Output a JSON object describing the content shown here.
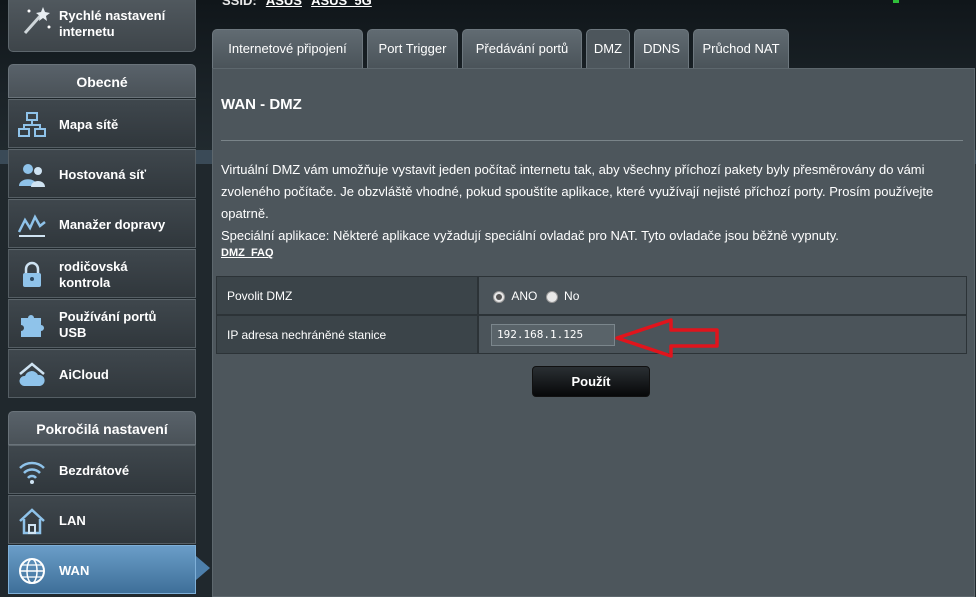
{
  "header": {
    "ssid_label": "SSID:",
    "ssid_1": "ASUS",
    "ssid_2": "ASUS_5G"
  },
  "sidebar": {
    "quick_setup": "Rychlé nastavení internetu",
    "general_header": "Obecné",
    "general_items": [
      {
        "label": "Mapa sítě",
        "icon": "network-map-icon"
      },
      {
        "label": "Hostovaná síť",
        "icon": "guest-network-icon"
      },
      {
        "label": "Manažer dopravy",
        "icon": "traffic-manager-icon"
      },
      {
        "label": "rodičovská kontrola",
        "icon": "parental-control-lock-icon"
      },
      {
        "label": "Používání portů USB",
        "icon": "usb-puzzle-icon"
      },
      {
        "label": "AiCloud",
        "icon": "aicloud-icon"
      }
    ],
    "advanced_header": "Pokročilá nastavení",
    "advanced_items": [
      {
        "label": "Bezdrátové",
        "icon": "wireless-icon"
      },
      {
        "label": "LAN",
        "icon": "home-lan-icon"
      },
      {
        "label": "WAN",
        "icon": "globe-wan-icon",
        "active": true
      }
    ]
  },
  "tabs": [
    {
      "label": "Internetové připojení"
    },
    {
      "label": "Port Trigger"
    },
    {
      "label": "Předávání portů"
    },
    {
      "label": "DMZ",
      "active": true
    },
    {
      "label": "DDNS"
    },
    {
      "label": "Průchod NAT"
    }
  ],
  "main": {
    "title": "WAN - DMZ",
    "description_1": "Virtuální DMZ vám umožňuje vystavit jeden počítač internetu tak, aby všechny příchozí pakety byly přesměrovány do vámi zvoleného počítače. Je obzvláště vhodné, pokud spouštíte aplikace, které využívají nejisté příchozí porty. Prosím používejte opatrně.",
    "description_2": "Speciální aplikace: Některé aplikace vyžadují speciální ovladač pro NAT. Tyto ovladače jsou běžně vypnuty.",
    "faq_link": "DMZ_FAQ",
    "enable_dmz_label": "Povolit DMZ",
    "enable_yes": "ANO",
    "enable_no": "No",
    "enable_value": "ANO",
    "ip_label": "IP adresa nechráněné stanice",
    "ip_value": "192.168.1.125",
    "apply_label": "Použít"
  },
  "colors": {
    "active_item": "#4d7fab",
    "annotation_arrow": "#e0141c",
    "panel_bg": "#4d565c"
  }
}
